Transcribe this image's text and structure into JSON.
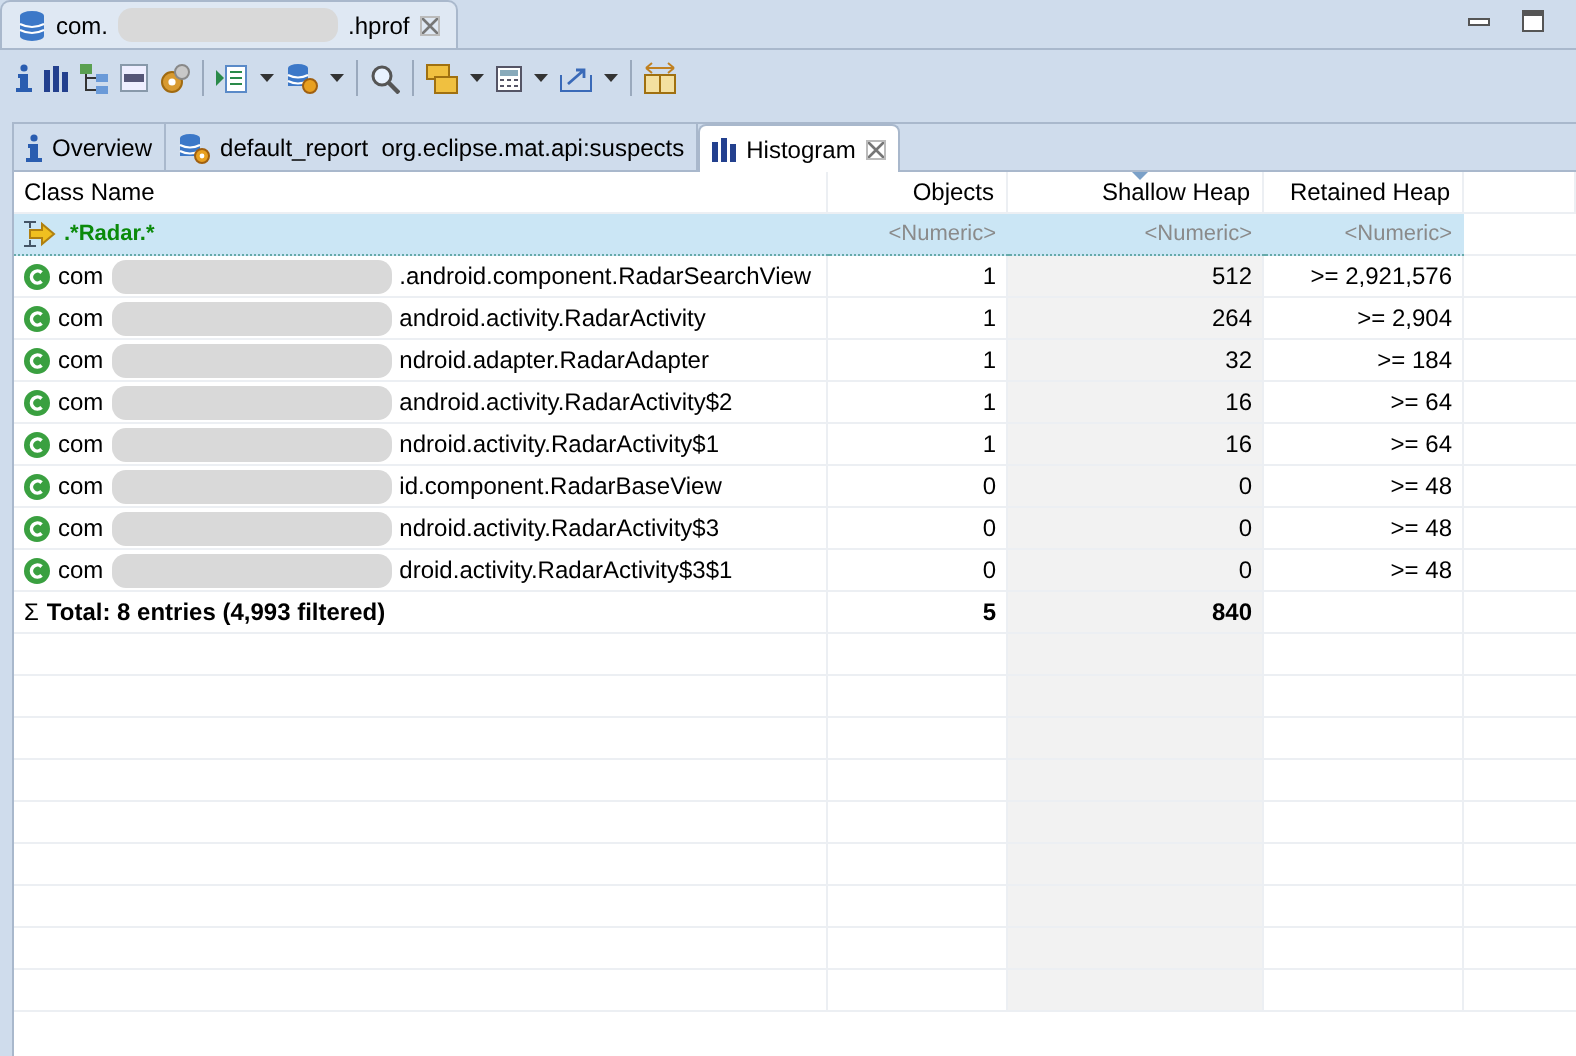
{
  "editor_tab": {
    "title_prefix": "com.",
    "title_suffix": ".hprof",
    "selected": true
  },
  "tabs": [
    {
      "kind": "info",
      "label": "Overview",
      "selected": false
    },
    {
      "kind": "report",
      "label": "default_report  org.eclipse.mat.api:suspects",
      "selected": false
    },
    {
      "kind": "histogram",
      "label": "Histogram",
      "selected": true
    }
  ],
  "table": {
    "columns": [
      {
        "label": "Class Name",
        "sorted": false
      },
      {
        "label": "Objects",
        "sorted": false
      },
      {
        "label": "Shallow Heap",
        "sorted": true
      },
      {
        "label": "Retained Heap",
        "sorted": false
      }
    ],
    "filter": [
      ".*Radar.*",
      "<Numeric>",
      "<Numeric>",
      "<Numeric>"
    ],
    "rows": [
      {
        "prefix": "com",
        "suffix": ".android.component.RadarSearchView",
        "objects": "1",
        "shallow": "512",
        "retained": ">= 2,921,576"
      },
      {
        "prefix": "com",
        "suffix": "android.activity.RadarActivity",
        "objects": "1",
        "shallow": "264",
        "retained": ">= 2,904"
      },
      {
        "prefix": "com",
        "suffix": "ndroid.adapter.RadarAdapter",
        "objects": "1",
        "shallow": "32",
        "retained": ">= 184"
      },
      {
        "prefix": "com",
        "suffix": "android.activity.RadarActivity$2",
        "objects": "1",
        "shallow": "16",
        "retained": ">= 64"
      },
      {
        "prefix": "com",
        "suffix": "ndroid.activity.RadarActivity$1",
        "objects": "1",
        "shallow": "16",
        "retained": ">= 64"
      },
      {
        "prefix": "com",
        "suffix": "id.component.RadarBaseView",
        "objects": "0",
        "shallow": "0",
        "retained": ">= 48"
      },
      {
        "prefix": "com",
        "suffix": "ndroid.activity.RadarActivity$3",
        "objects": "0",
        "shallow": "0",
        "retained": ">= 48"
      },
      {
        "prefix": "com",
        "suffix": "droid.activity.RadarActivity$3$1",
        "objects": "0",
        "shallow": "0",
        "retained": ">= 48"
      }
    ],
    "total": {
      "symbol": "Σ",
      "label": "Total: 8 entries (4,993 filtered)",
      "objects": "5",
      "shallow": "840"
    }
  }
}
